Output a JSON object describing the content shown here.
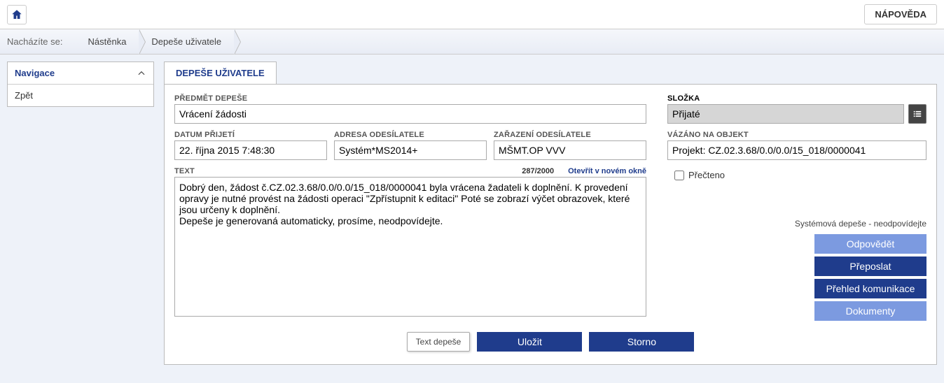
{
  "topbar": {
    "help": "NÁPOVĚDA"
  },
  "breadcrumb": {
    "label": "Nacházíte se:",
    "items": [
      "Nástěnka",
      "Depeše uživatele"
    ]
  },
  "sidebar": {
    "nav_title": "Navigace",
    "back": "Zpět"
  },
  "tab_title": "DEPEŠE UŽIVATELE",
  "labels": {
    "subject": "PŘEDMĚT DEPEŠE",
    "date": "DATUM PŘIJETÍ",
    "sender": "ADRESA ODESÍLATELE",
    "sender_class": "ZAŘAZENÍ ODESÍLATELE",
    "folder": "SLOŽKA",
    "bound": "VÁZÁNO NA OBJEKT",
    "text": "TEXT",
    "read": "Přečteno",
    "open_new": "Otevřít v novém okně"
  },
  "form": {
    "subject": "Vrácení žádosti",
    "date": "22. října 2015 7:48:30",
    "sender": "Systém*MS2014+",
    "sender_class": "MŠMT.OP VVV",
    "folder": "Přijaté",
    "bound": "Projekt: CZ.02.3.68/0.0/0.0/15_018/0000041",
    "counter": "287/2000",
    "text": "Dobrý den, žádost č.CZ.02.3.68/0.0/0.0/15_018/0000041 byla vrácena žadateli k doplnění. K provedení opravy je nutné provést na žádosti operaci \"Zpřístupnit k editaci\" Poté se zobrazí výčet obrazovek, které jsou určeny k doplnění.\nDepeše je generovaná automaticky, prosíme, neodpovídejte."
  },
  "actions": {
    "sys_note": "Systémová depeše - neodpovídejte",
    "reply": "Odpovědět",
    "forward": "Přeposlat",
    "overview": "Přehled komunikace",
    "documents": "Dokumenty"
  },
  "bottom": {
    "tooltip": "Text depeše",
    "save": "Uložit",
    "cancel": "Storno"
  }
}
